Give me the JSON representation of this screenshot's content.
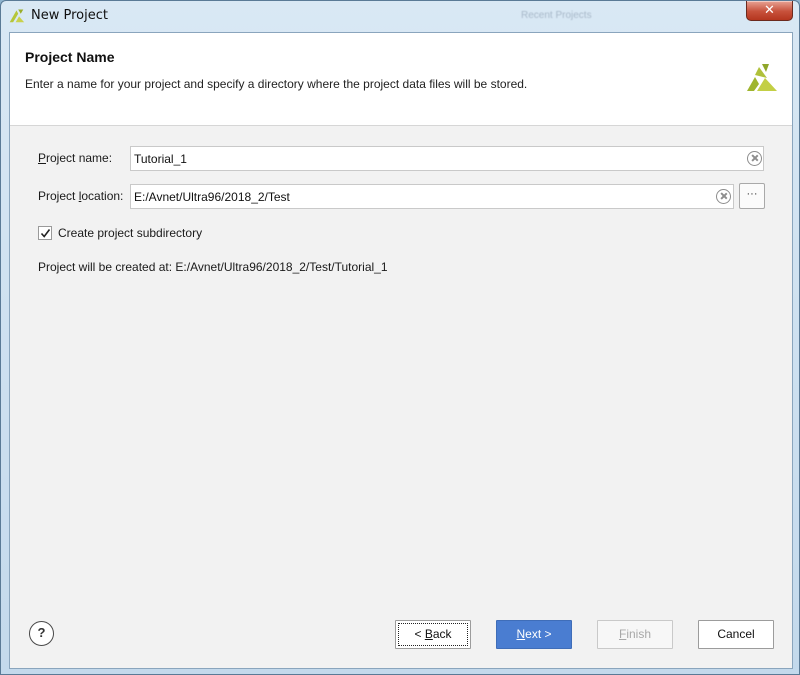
{
  "window": {
    "title": "New Project",
    "ghost_title": "Recent Projects",
    "close_label": "✕"
  },
  "header": {
    "title": "Project Name",
    "description": "Enter a name for your project and specify a directory where the project data files will be stored."
  },
  "form": {
    "project_name": {
      "label_underlined": "P",
      "label_rest": "roject name:",
      "value": "Tutorial_1"
    },
    "project_location": {
      "label_prefix": "Project ",
      "label_underlined": "l",
      "label_rest": "ocation:",
      "value": "E:/Avnet/Ultra96/2018_2/Test",
      "browse_label": "···"
    },
    "create_subdirectory": {
      "label": "Create project subdirectory",
      "checked": true
    },
    "created_at_text": "Project will be created at: E:/Avnet/Ultra96/2018_2/Test/Tutorial_1"
  },
  "footer": {
    "help_label": "?",
    "back_prefix": "< ",
    "back_underlined": "B",
    "back_rest": "ack",
    "next_underlined": "N",
    "next_rest": "ext >",
    "finish_underlined": "F",
    "finish_rest": "inish",
    "cancel_label": "Cancel"
  },
  "colors": {
    "accent": "#4a7dd1",
    "logo_green": "#b5c63a"
  }
}
